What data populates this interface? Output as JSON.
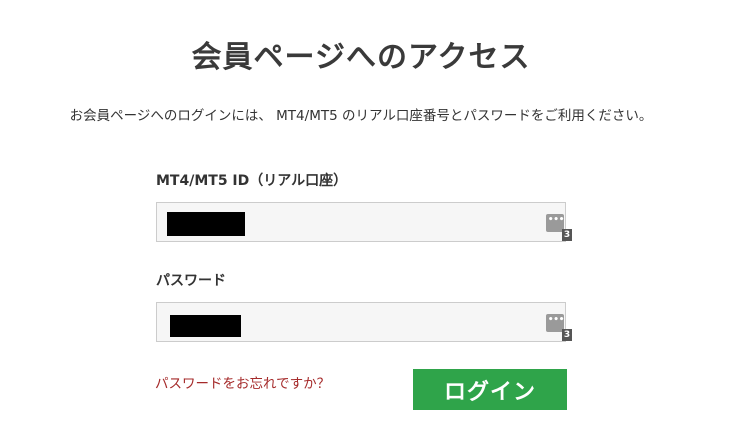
{
  "page": {
    "title": "会員ページへのアクセス",
    "intro": "お会員ページへのログインには、 MT4/MT5 のリアル口座番号とパスワードをご利用ください。"
  },
  "form": {
    "account_field": {
      "label": "MT4/MT5 ID（リアル口座）",
      "value_redacted": true,
      "password_manager_badge": "3",
      "password_manager_dots": "•••"
    },
    "password_field": {
      "label": "パスワード",
      "value_redacted": true,
      "password_manager_badge": "3",
      "password_manager_dots": "•••"
    },
    "forgot_password_link": "パスワードをお忘れですか？",
    "login_button": "ログイン"
  },
  "colors": {
    "title": "#3a3a3a",
    "link": "#a52a2a",
    "button": "#2fa44a",
    "input_bg": "#f6f6f6"
  },
  "icons": {
    "password_manager": "password-manager-icon"
  }
}
